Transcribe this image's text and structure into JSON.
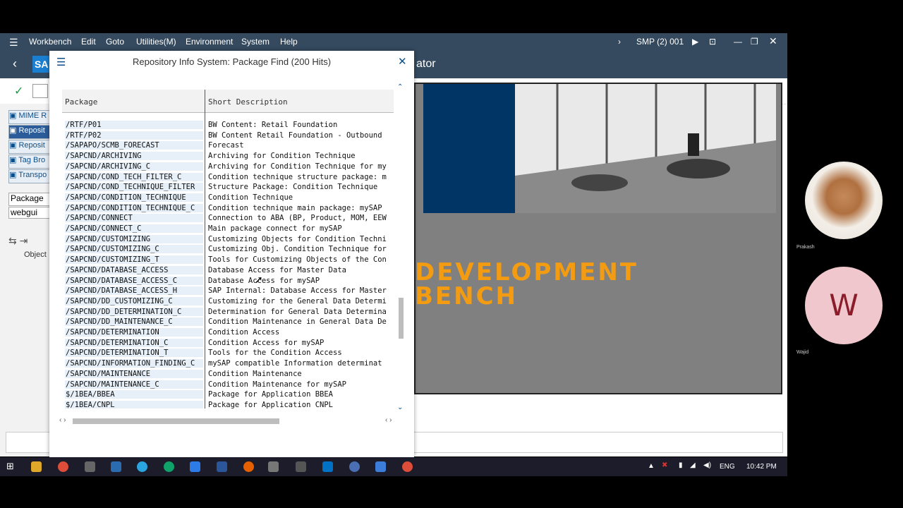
{
  "menu": {
    "items": [
      "Workbench",
      "Edit",
      "Goto",
      "Utilities(M)",
      "Environment",
      "System",
      "Help"
    ],
    "system": "SMP (2) 001"
  },
  "titlebar": {
    "title_fragment": "ator",
    "logo": "SA"
  },
  "leftnav": {
    "items": [
      {
        "label": "MIME R"
      },
      {
        "label": "Reposit"
      },
      {
        "label": "Reposit"
      },
      {
        "label": "Tag Bro"
      },
      {
        "label": "Transpo"
      }
    ],
    "package_label": "Package",
    "package_value": "webgui",
    "object_label": "Object"
  },
  "dialog": {
    "title": "Repository Info System: Package Find (200 Hits)",
    "columns": [
      "Package",
      "Short Description"
    ],
    "rows": [
      {
        "pkg": "/RTF/P01",
        "desc": "BW Content: Retail Foundation"
      },
      {
        "pkg": "/RTF/P02",
        "desc": "BW Content Retail Foundation - Outbound"
      },
      {
        "pkg": "/SAPAPO/SCMB_FORECAST",
        "desc": "Forecast"
      },
      {
        "pkg": "/SAPCND/ARCHIVING",
        "desc": "Archiving for Condition Technique"
      },
      {
        "pkg": "/SAPCND/ARCHIVING_C",
        "desc": "Archiving for Condition Technique for my"
      },
      {
        "pkg": "/SAPCND/COND_TECH_FILTER_C",
        "desc": "Condition technique structure package: m"
      },
      {
        "pkg": "/SAPCND/COND_TECHNIQUE_FILTER",
        "desc": "Structure Package: Condition Technique"
      },
      {
        "pkg": "/SAPCND/CONDITION_TECHNIQUE",
        "desc": "Condition Technique"
      },
      {
        "pkg": "/SAPCND/CONDITION_TECHNIQUE_C",
        "desc": "Condition technique main package: mySAP"
      },
      {
        "pkg": "/SAPCND/CONNECT",
        "desc": "Connection to ABA (BP, Product, MOM, EEW"
      },
      {
        "pkg": "/SAPCND/CONNECT_C",
        "desc": "Main package connect for mySAP"
      },
      {
        "pkg": "/SAPCND/CUSTOMIZING",
        "desc": "Customizing Objects for Condition Techni"
      },
      {
        "pkg": "/SAPCND/CUSTOMIZING_C",
        "desc": "Customizing Obj. Condition Technique for"
      },
      {
        "pkg": "/SAPCND/CUSTOMIZING_T",
        "desc": "Tools for Customizing Objects of the Con"
      },
      {
        "pkg": "/SAPCND/DATABASE_ACCESS",
        "desc": "Database Access for Master Data"
      },
      {
        "pkg": "/SAPCND/DATABASE_ACCESS_C",
        "desc": "Database Access for mySAP"
      },
      {
        "pkg": "/SAPCND/DATABASE_ACCESS_H",
        "desc": "SAP Internal: Database Access for Master"
      },
      {
        "pkg": "/SAPCND/DD_CUSTOMIZING_C",
        "desc": "Customizing for the General Data Determi"
      },
      {
        "pkg": "/SAPCND/DD_DETERMINATION_C",
        "desc": "Determination for General Data Determina"
      },
      {
        "pkg": "/SAPCND/DD_MAINTENANCE_C",
        "desc": "Condition Maintenance in General Data De"
      },
      {
        "pkg": "/SAPCND/DETERMINATION",
        "desc": "Condition Access"
      },
      {
        "pkg": "/SAPCND/DETERMINATION_C",
        "desc": "Condition Access for mySAP"
      },
      {
        "pkg": "/SAPCND/DETERMINATION_T",
        "desc": "Tools for the Condition Access"
      },
      {
        "pkg": "/SAPCND/INFORMATION_FINDING_C",
        "desc": " mySAP compatible Information determinat"
      },
      {
        "pkg": "/SAPCND/MAINTENANCE",
        "desc": "Condition Maintenance"
      },
      {
        "pkg": "/SAPCND/MAINTENANCE_C",
        "desc": "Condition Maintenance for mySAP"
      },
      {
        "pkg": "$/1BEA/BBEA",
        "desc": "Package for Application BBEA"
      },
      {
        "pkg": "$/1BEA/CNPL",
        "desc": "Package for Application CNPL"
      }
    ]
  },
  "slide": {
    "line1": "DEVELOPMENT",
    "line2": "BENCH"
  },
  "participants": [
    {
      "name": "Prakash"
    },
    {
      "name": "Wajid",
      "initial": "W"
    }
  ],
  "taskbar": {
    "lang": "ENG",
    "time": "10:42 PM"
  },
  "colors": {
    "sap_shell": "#354a5f",
    "slide_blue": "#003566",
    "orange": "#f39c12",
    "avatar_pink": "#f0c7cc",
    "avatar_letter": "#8b1d2a"
  }
}
